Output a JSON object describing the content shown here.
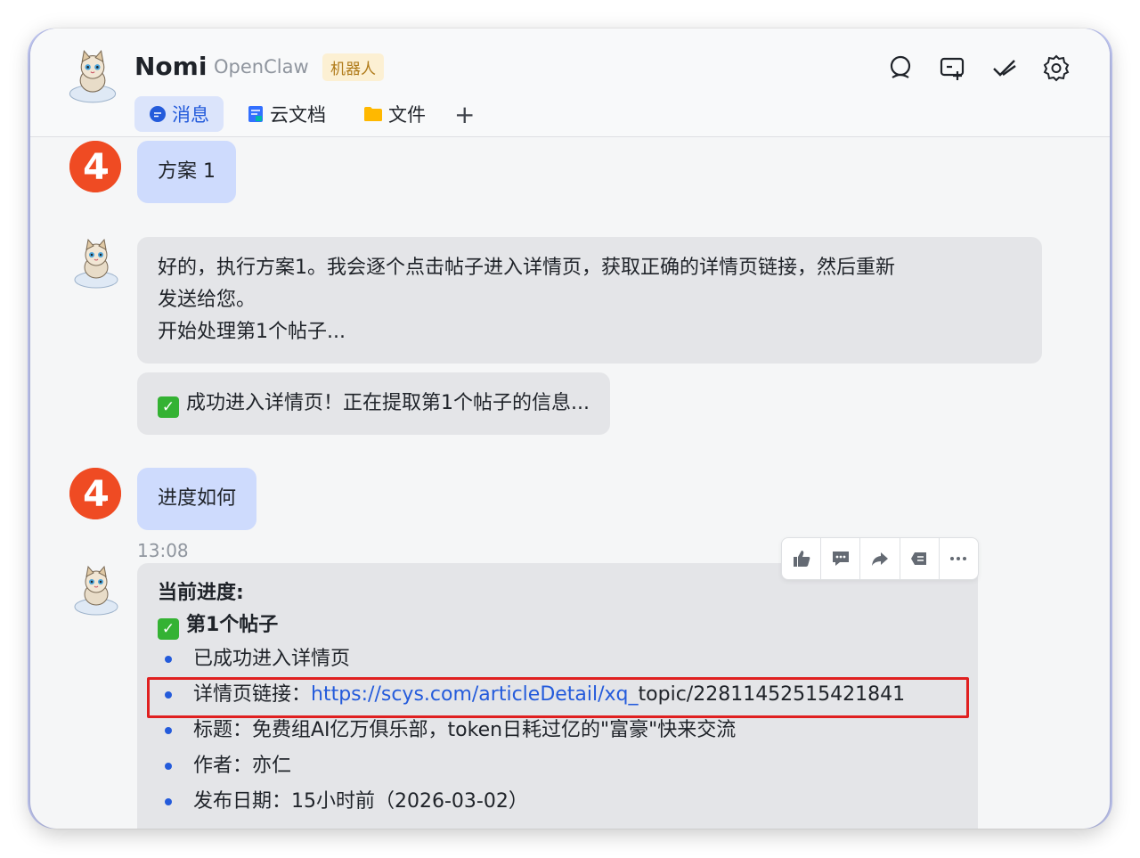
{
  "header": {
    "name": "Nomi",
    "subtitle": "OpenClaw",
    "badge": "机器人",
    "icons": [
      "search-icon",
      "add-chat-icon",
      "done-check-icon",
      "settings-gear-icon"
    ]
  },
  "tabs": [
    {
      "label": "消息",
      "icon": "chat-bubble-icon",
      "active": true
    },
    {
      "label": "云文档",
      "icon": "doc-icon",
      "active": false
    },
    {
      "label": "文件",
      "icon": "folder-icon",
      "active": false
    },
    {
      "label": "+",
      "icon": "plus-icon",
      "active": false
    }
  ],
  "messages": {
    "m1": {
      "sender": "user",
      "text": "方案 1"
    },
    "m2": {
      "sender": "bot",
      "lines": [
        "好的，执行方案1。我会逐个点击帖子进入详情页，获取正确的详情页链接，然后重新",
        "发送给您。",
        "开始处理第1个帖子..."
      ]
    },
    "m3": {
      "sender": "bot",
      "text": "成功进入详情页！正在提取第1个帖子的信息..."
    },
    "m4": {
      "sender": "user",
      "text": "进度如何"
    },
    "time": "13:08",
    "m5": {
      "sender": "bot",
      "title": "当前进度:",
      "subtitle": "第1个帖子",
      "items": [
        "已成功进入详情页",
        "详情页链接：",
        "标题：免费组AI亿万俱乐部，token日耗过亿的\"富豪\"快来交流",
        "作者：亦仁",
        "发布日期：15小时前（2026-03-02）"
      ],
      "link_url": "https://scys.com/articleDetail/xq_",
      "link_tail": "topic/22811452515421841"
    }
  },
  "toolbar": [
    "thumbs-up-icon",
    "comment-icon",
    "forward-icon",
    "pin-icon",
    "more-icon"
  ],
  "colors": {
    "accent": "#245bdb",
    "user_bubble": "#cedbfd",
    "bot_bubble": "#e4e5e8",
    "highlight_box": "#e02020",
    "user_avatar": "#ef4b23"
  }
}
